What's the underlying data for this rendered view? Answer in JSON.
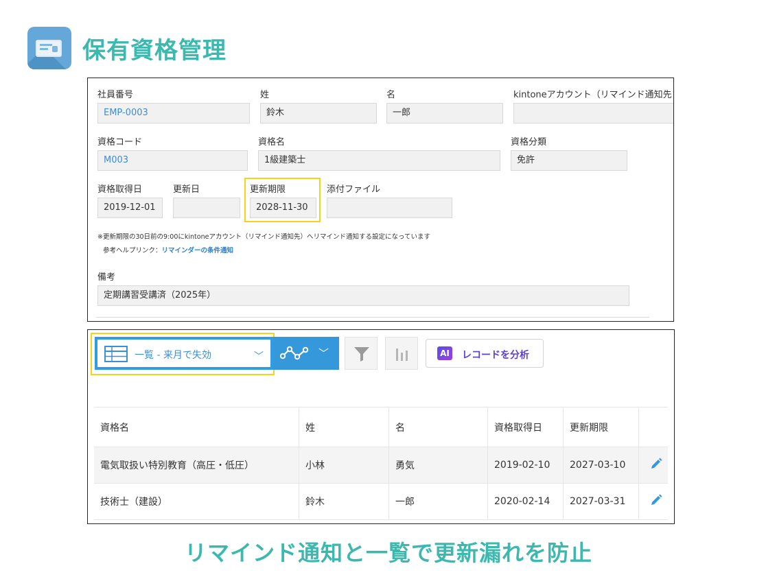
{
  "app": {
    "title": "保有資格管理"
  },
  "record": {
    "fields": {
      "employee_no": {
        "label": "社員番号",
        "value": "EMP-0003"
      },
      "last_name": {
        "label": "姓",
        "value": "鈴木"
      },
      "first_name": {
        "label": "名",
        "value": "一郎"
      },
      "kintone_account": {
        "label": "kintoneアカウント（リマインド通知先",
        "value": ""
      },
      "cert_code": {
        "label": "資格コード",
        "value": "M003"
      },
      "cert_name": {
        "label": "資格名",
        "value": "1級建築士"
      },
      "cert_category": {
        "label": "資格分類",
        "value": "免許"
      },
      "acquired_date": {
        "label": "資格取得日",
        "value": "2019-12-01"
      },
      "renewed_date": {
        "label": "更新日",
        "value": ""
      },
      "expiry_date": {
        "label": "更新期限",
        "value": "2028-11-30"
      },
      "attachment": {
        "label": "添付ファイル",
        "value": ""
      },
      "notes": {
        "label": "備考",
        "value": "定期講習受講済（2025年）"
      }
    },
    "notice": "※更新期限の30日前の9:00にkintoneアカウント（リマインド通知先）へリマインド通知する設定になっています",
    "help_prefix": "参考ヘルプリンク：",
    "help_link": "リマインダーの条件通知"
  },
  "list": {
    "view_select": "一覧 - 来月で失効",
    "ai_button": "レコードを分析",
    "ai_badge": "AI",
    "columns": [
      "資格名",
      "姓",
      "名",
      "資格取得日",
      "更新期限"
    ],
    "rows": [
      [
        "電気取扱い特別教育（高圧・低圧）",
        "小林",
        "勇気",
        "2019-02-10",
        "2027-03-10"
      ],
      [
        "技術士（建設）",
        "鈴木",
        "一郎",
        "2020-02-14",
        "2027-03-31"
      ]
    ]
  },
  "caption": "リマインド通知と一覧で更新漏れを防止",
  "colors": {
    "accent": "#3cb8ae",
    "primary": "#3498db",
    "highlight": "#f7d21a",
    "link": "#3f8bd6"
  }
}
